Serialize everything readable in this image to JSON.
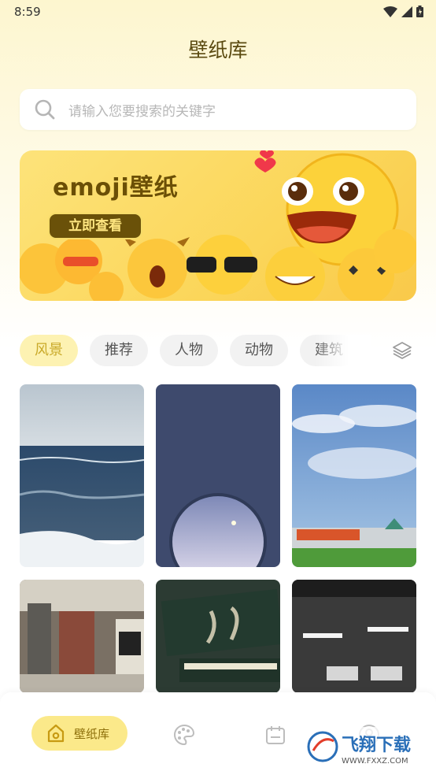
{
  "status_bar": {
    "time": "8:59"
  },
  "header": {
    "title": "壁纸库"
  },
  "search": {
    "placeholder": "请输入您要搜索的关键字"
  },
  "banner": {
    "title": "emoji壁纸",
    "button_label": "立即查看"
  },
  "category_tabs": [
    {
      "label": "风景",
      "active": true
    },
    {
      "label": "推荐",
      "active": false
    },
    {
      "label": "人物",
      "active": false
    },
    {
      "label": "动物",
      "active": false
    },
    {
      "label": "建筑",
      "active": false
    }
  ],
  "wallpapers": [
    {
      "name": "ocean-waves"
    },
    {
      "name": "night-window-moon"
    },
    {
      "name": "sky-field-building"
    },
    {
      "name": "city-street"
    },
    {
      "name": "book-stack"
    },
    {
      "name": "station-ceiling"
    }
  ],
  "bottom_nav": {
    "home_label": "壁纸库",
    "items": [
      "home-icon",
      "palette-icon",
      "calendar-icon",
      "profile-icon"
    ]
  },
  "watermark": {
    "brand": "飞翔下载",
    "url": "WWW.FXXZ.COM"
  },
  "colors": {
    "accent": "#fbe98a",
    "accent_text": "#c9a928",
    "title": "#5a4a10"
  }
}
